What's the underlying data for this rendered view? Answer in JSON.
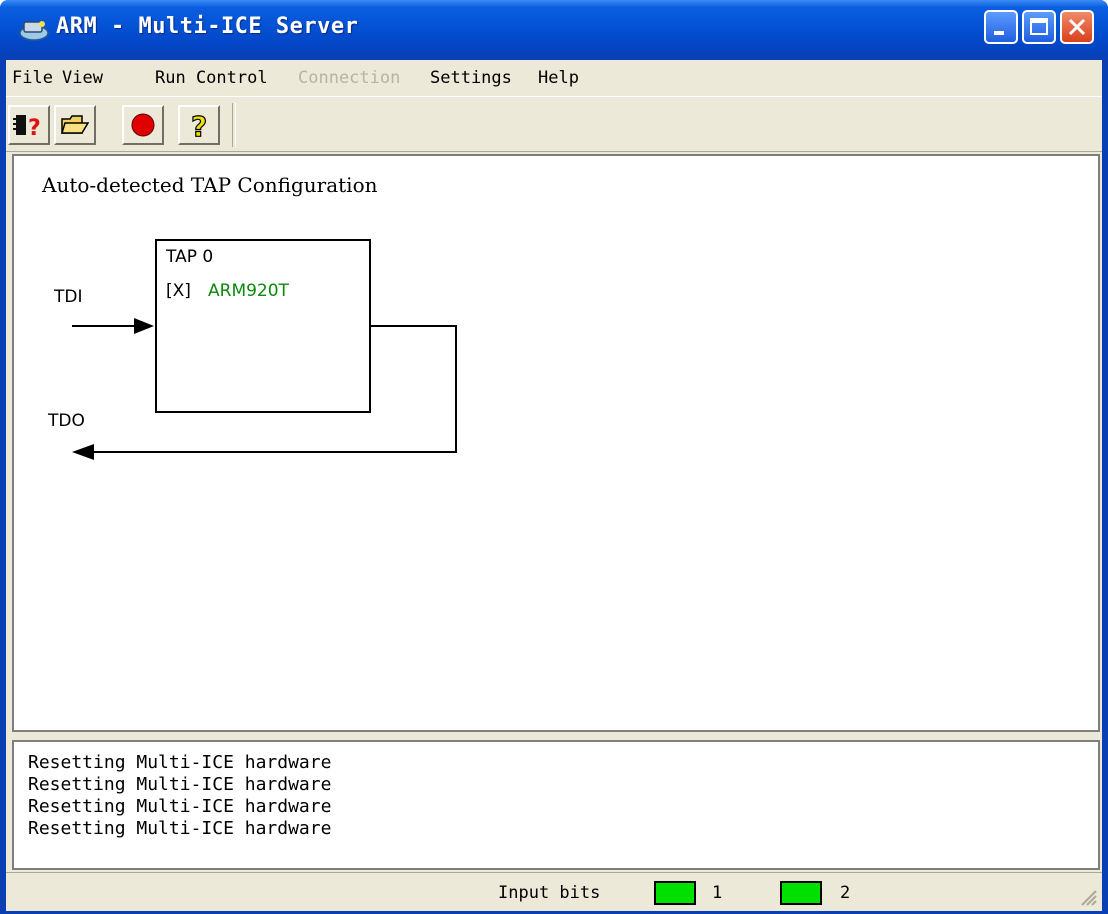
{
  "window": {
    "title": "ARM - Multi-ICE Server"
  },
  "icons": {
    "app": "multi-ice-app-icon",
    "minimize": "minimize-icon",
    "maximize": "maximize-icon",
    "close": "close-icon",
    "toolbar": [
      "autoconfigure-icon",
      "open-folder-icon",
      "record-icon",
      "help-icon"
    ]
  },
  "menu": [
    {
      "label": "File",
      "enabled": true
    },
    {
      "label": "View",
      "enabled": true
    },
    {
      "label": "Run Control",
      "enabled": true
    },
    {
      "label": "Connection",
      "enabled": false
    },
    {
      "label": "Settings",
      "enabled": true
    },
    {
      "label": "Help",
      "enabled": true
    }
  ],
  "diagram": {
    "heading": "Auto-detected TAP Configuration",
    "tdi_label": "TDI",
    "tdo_label": "TDO",
    "tap": {
      "name": "TAP 0",
      "checkbox": "[X]",
      "device": "ARM920T",
      "device_color": "#0a8a0a"
    }
  },
  "log": [
    "Resetting Multi-ICE hardware",
    "Resetting Multi-ICE hardware",
    "Resetting Multi-ICE hardware",
    "Resetting Multi-ICE hardware"
  ],
  "status": {
    "label": "Input bits",
    "bits": [
      {
        "label": "1",
        "color": "#00e000"
      },
      {
        "label": "2",
        "color": "#00e000"
      }
    ]
  }
}
